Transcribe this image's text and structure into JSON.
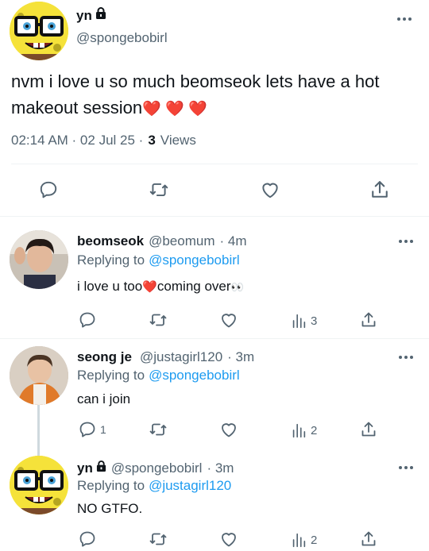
{
  "main_tweet": {
    "display_name": "yn",
    "handle": "@spongebobirl",
    "text": "nvm i love u so much beomseok lets have a hot makeout session",
    "hearts": "❤️ ❤️ ❤️",
    "timestamp": "02:14 AM · 02 Jul 25 ·",
    "views_count": "3",
    "views_label": "Views"
  },
  "replies": [
    {
      "display_name": "beomseok",
      "handle": "@beomum",
      "time": "· 4m",
      "replying_label": "Replying to",
      "replying_to": "@spongebobirl",
      "text_before": "i love u too",
      "text_after": "coming over",
      "emoji_after": "👀",
      "reply_count": "",
      "view_count": "3"
    },
    {
      "display_name": "seong je",
      "handle": "@justagirl120",
      "time": "· 3m",
      "replying_label": "Replying to",
      "replying_to": "@spongebobirl",
      "text": "can i join",
      "reply_count": "1",
      "view_count": "2"
    },
    {
      "display_name": "yn",
      "handle": "@spongebobirl",
      "time": "· 3m",
      "replying_label": "Replying to",
      "replying_to": "@justagirl120",
      "text": "NO GTFO.",
      "reply_count": "",
      "view_count": "2"
    }
  ],
  "icons": {
    "lock": "lock-icon",
    "more": "more-icon",
    "reply": "reply-icon",
    "retweet": "retweet-icon",
    "like": "heart-icon",
    "views": "views-icon",
    "share": "share-icon"
  },
  "colors": {
    "accent": "#1d9bf0",
    "muted": "#536471",
    "heart": "#e0245e"
  }
}
